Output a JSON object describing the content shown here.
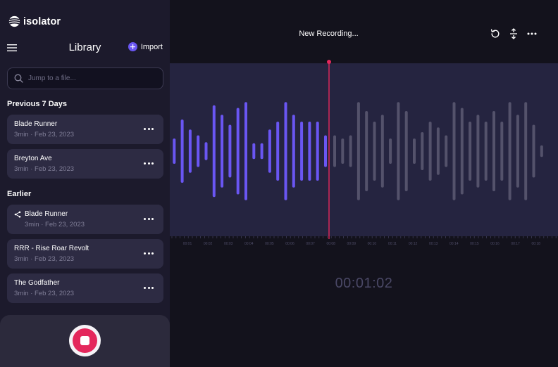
{
  "app": {
    "logo_text": "isolator"
  },
  "library": {
    "title": "Library",
    "import_label": "Import",
    "search_placeholder": "Jump to a file...",
    "sections": [
      {
        "title": "Previous 7 Days",
        "items": [
          {
            "title": "Blade Runner",
            "meta": "3min · Feb 23, 2023",
            "shared": false
          },
          {
            "title": "Breyton Ave",
            "meta": "3min · Feb 23, 2023",
            "shared": false
          }
        ]
      },
      {
        "title": "Earlier",
        "items": [
          {
            "title": "Blade Runner",
            "meta": "3min · Feb 23, 2023",
            "shared": true
          },
          {
            "title": "RRR - Rise Roar Revolt",
            "meta": "3min · Feb 23, 2023",
            "shared": false
          },
          {
            "title": "The Godfather",
            "meta": "3min · Feb 23, 2023",
            "shared": false
          }
        ]
      }
    ]
  },
  "recording": {
    "title": "New Recording...",
    "timer": "00:01:02",
    "ruler_labels": [
      "00:01",
      "00:02",
      "00:03",
      "00:04",
      "00:05",
      "00:06",
      "00:07",
      "00:08",
      "00:09",
      "00:10",
      "00:11",
      "00:12",
      "00:13",
      "00:14",
      "00:15",
      "00:16",
      "00:17",
      "00:18"
    ],
    "played_bar_levels": [
      0.24,
      0.6,
      0.41,
      0.3,
      0.17,
      0.87,
      0.69,
      0.5,
      0.82,
      0.93,
      0.15,
      0.15,
      0.41,
      0.56,
      0.93,
      0.69,
      0.56,
      0.56,
      0.56,
      0.3
    ],
    "future_bar_levels": [
      0.3,
      0.24,
      0.3,
      0.93,
      0.76,
      0.56,
      0.69,
      0.24,
      0.93,
      0.76,
      0.24,
      0.36,
      0.56,
      0.45,
      0.3,
      0.93,
      0.82,
      0.56,
      0.69,
      0.56,
      0.76,
      0.56,
      0.93,
      0.69,
      0.93,
      0.5,
      0.11
    ],
    "playhead_fraction": 0.41
  },
  "colors": {
    "accent": "#6a56f3",
    "played_bar": "#6a56f3",
    "future_bar": "#54526b",
    "playhead": "#e4275c",
    "stop": "#e4275c"
  },
  "icons": {
    "logo": "isolator-logo-icon",
    "menu": "hamburger-menu-icon",
    "import": "plus-circle-icon",
    "search": "search-icon",
    "share": "share-icon",
    "more": "more-horizontal-icon",
    "stop": "stop-icon",
    "undo": "rotate-ccw-icon",
    "resize": "vertical-resize-icon"
  }
}
